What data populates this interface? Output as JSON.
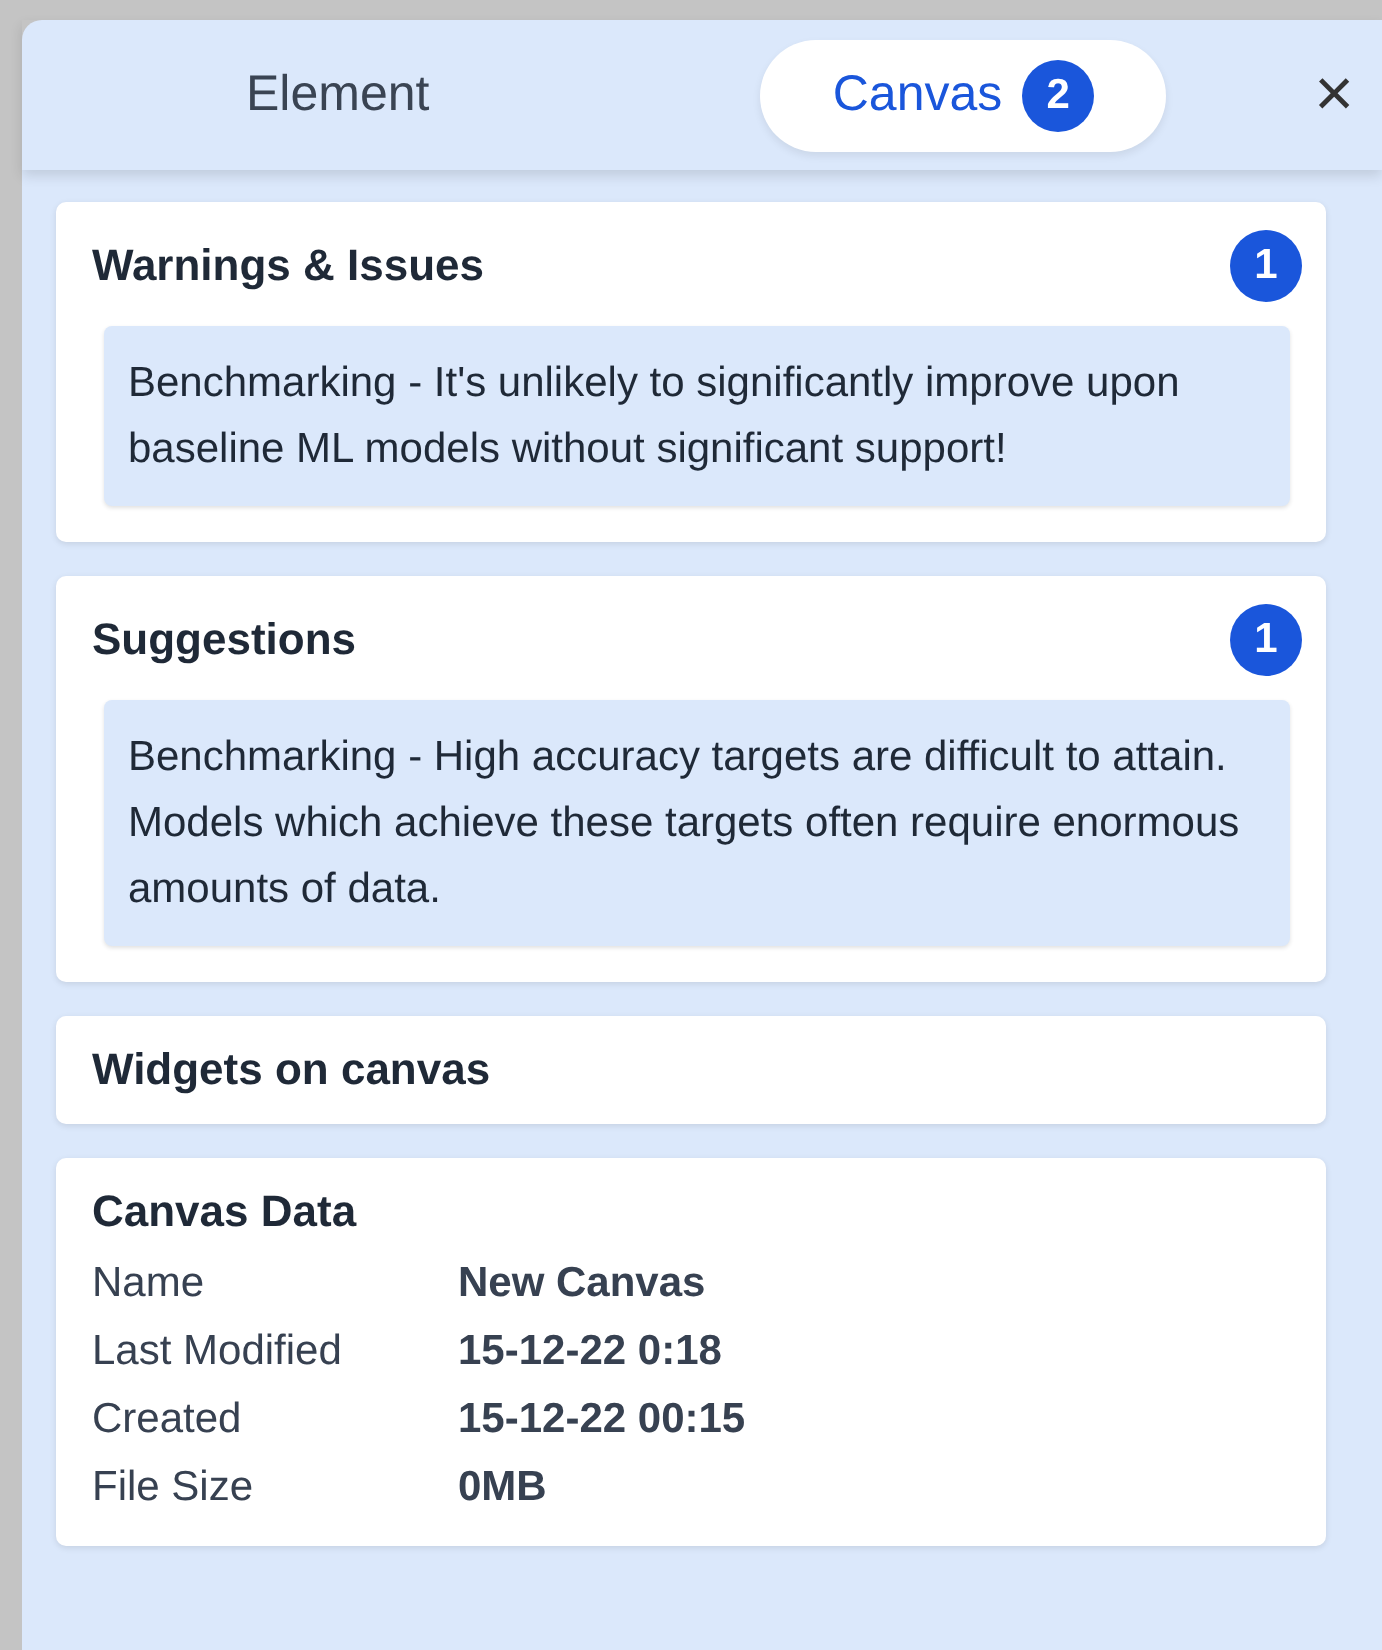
{
  "tabs": [
    {
      "label": "Element",
      "selected": false
    },
    {
      "label": "Canvas",
      "selected": true,
      "badge": "2"
    }
  ],
  "close": "×",
  "sections": [
    {
      "kind": "messages",
      "title": "Warnings & Issues",
      "count": "1",
      "messages": [
        "Benchmarking - It's unlikely to significantly improve upon baseline ML models without significant support!"
      ]
    },
    {
      "kind": "messages",
      "title": "Suggestions",
      "count": "1",
      "messages": [
        "Benchmarking - High accuracy targets are difficult to attain. Models which achieve these targets often require enormous amounts of data."
      ]
    },
    {
      "kind": "collapsed",
      "title": "Widgets on canvas"
    },
    {
      "kind": "details",
      "title": "Canvas Data",
      "rows": [
        {
          "label": "Name",
          "value": "New Canvas"
        },
        {
          "label": "Last Modified",
          "value": "15-12-22 0:18"
        },
        {
          "label": "Created",
          "value": "15-12-22 00:15"
        },
        {
          "label": "File Size",
          "value": "0MB"
        }
      ]
    }
  ]
}
